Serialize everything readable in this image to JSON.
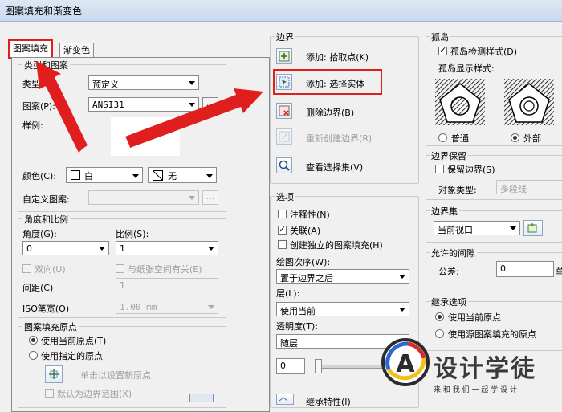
{
  "window": {
    "title": "图案填充和渐变色"
  },
  "tabs": [
    {
      "label": "图案填充"
    },
    {
      "label": "渐变色"
    }
  ],
  "type_pattern": {
    "group_title": "类型和图案",
    "type_label": "类型(Y):",
    "type_value": "预定义",
    "pattern_label": "图案(P):",
    "pattern_value": "ANSI31",
    "dots": "...",
    "sample_label": "样例:",
    "color_label": "颜色(C):",
    "color_value": "白",
    "bg_value": "无",
    "custom_label": "自定义图案:",
    "custom_dots": "..."
  },
  "angle_scale": {
    "group_title": "角度和比例",
    "angle_label": "角度(G):",
    "angle_value": "0",
    "scale_label": "比例(S):",
    "scale_value": "1",
    "double_label": "双向(U)",
    "relative_label": "与纸张空间有关(E)",
    "spacing_label": "间距(C)",
    "spacing_value": "1",
    "iso_label": "ISO笔宽(O)",
    "iso_value": "1.00 mm"
  },
  "origin": {
    "group_title": "图案填充原点",
    "use_current": "使用当前原点(T)",
    "use_specified": "使用指定的原点",
    "click_set": "单击以设置新原点",
    "default_extent": "默认为边界范围(X)"
  },
  "boundaries": {
    "group_title": "边界",
    "add_pick": "添加: 拾取点(K)",
    "add_select": "添加: 选择实体",
    "remove": "删除边界(B)",
    "recreate": "重新创建边界(R)",
    "view_select": "查看选择集(V)"
  },
  "options": {
    "group_title": "选项",
    "annotative": "注释性(N)",
    "associative": "关联(A)",
    "separate": "创建独立的图案填充(H)",
    "draw_order_label": "绘图次序(W):",
    "draw_order_value": "置于边界之后",
    "layer_label": "层(L):",
    "layer_value": "使用当前",
    "transparency_label": "透明度(T):",
    "transparency_mode": "随层",
    "transparency_value": "0",
    "inherit_label": "继承特性(I)"
  },
  "islands": {
    "group_title": "孤岛",
    "detect_label": "孤岛检测样式(D)",
    "display_label": "孤岛显示样式:",
    "normal": "普通",
    "outer": "外部"
  },
  "retain": {
    "group_title": "边界保留",
    "retain_label": "保留边界(S)",
    "object_type_label": "对象类型:",
    "object_type_value": "多段线"
  },
  "boundary_set": {
    "group_title": "边界集",
    "value": "当前视口"
  },
  "gap": {
    "group_title": "允许的间隙",
    "tolerance_label": "公差:",
    "tolerance_value": "0",
    "unit": "单"
  },
  "inherit_options": {
    "group_title": "继承选项",
    "use_current": "使用当前原点",
    "use_source": "使用源图案填充的原点"
  },
  "watermark": {
    "brand": "设计学徒",
    "slogan": "来 和 我 们 一 起 学 设 计",
    "letter": "A"
  },
  "colors": {
    "annotation_red": "#e01e1e",
    "title_gradient_top": "#dde8f5"
  }
}
